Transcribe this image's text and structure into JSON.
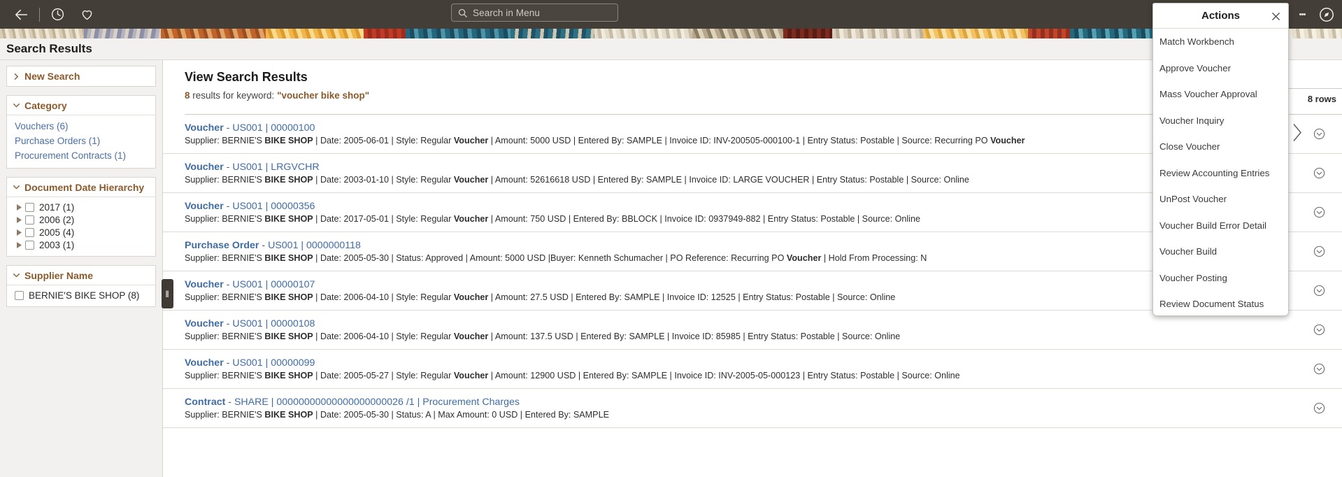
{
  "topbar": {
    "back_icon": "back-arrow-icon",
    "history_icon": "clock-icon",
    "favorites_icon": "heart-icon",
    "kebab_icon": "more-options-icon",
    "nav_icon": "compass-navbar-icon",
    "search": {
      "placeholder": "Search in Menu",
      "value": "",
      "icon": "search-icon"
    }
  },
  "page": {
    "title": "Search Results"
  },
  "sidebar": {
    "new_search": {
      "label": "New Search",
      "icon": "chevron-right-icon"
    },
    "facets": [
      {
        "title": "Category",
        "icon": "chevron-down-icon",
        "links": [
          "Vouchers (6)",
          "Purchase Orders (1)",
          "Procurement Contracts (1)"
        ]
      },
      {
        "title": "Document Date Hierarchy",
        "icon": "chevron-down-icon",
        "tree": [
          {
            "label": "2017 (1)",
            "checked": false
          },
          {
            "label": "2006 (2)",
            "checked": false
          },
          {
            "label": "2005 (4)",
            "checked": false
          },
          {
            "label": "2003 (1)",
            "checked": false
          }
        ]
      },
      {
        "title": "Supplier Name",
        "icon": "chevron-down-icon",
        "checkboxes": [
          {
            "label": "BERNIE'S BIKE SHOP (8)",
            "checked": false
          }
        ]
      }
    ],
    "collapse_handle": "‖"
  },
  "main": {
    "heading": "View Search Results",
    "result_count": "8",
    "results_text_mid": " results for keyword: ",
    "keyword": "\"voucher bike shop\"",
    "rows_badge": "8 rows",
    "results": [
      {
        "type": "Voucher",
        "sep": " - ",
        "ref": "US001 | 00000100",
        "detail": "Supplier: BERNIE'S BIKE SHOP | Date: 2005-06-01 | Style: Regular Voucher | Amount: 5000 USD | Entered By: SAMPLE | Invoice ID: INV-200505-000100-1 | Entry Status: Postable | Source: Recurring PO Voucher"
      },
      {
        "type": "Voucher",
        "sep": " - ",
        "ref": "US001 | LRGVCHR",
        "detail": "Supplier: BERNIE'S BIKE SHOP | Date: 2003-01-10 | Style: Regular Voucher | Amount: 52616618 USD | Entered By: SAMPLE | Invoice ID: LARGE VOUCHER | Entry Status: Postable | Source: Online"
      },
      {
        "type": "Voucher",
        "sep": " - ",
        "ref": "US001 | 00000356",
        "detail": "Supplier: BERNIE'S BIKE SHOP | Date: 2017-05-01 | Style: Regular Voucher | Amount: 750 USD | Entered By: BBLOCK | Invoice ID: 0937949-882 | Entry Status: Postable | Source: Online"
      },
      {
        "type": "Purchase Order",
        "sep": " - ",
        "ref": "US001 | 0000000118",
        "detail": "Supplier: BERNIE'S BIKE SHOP | Date: 2005-05-30 | Status: Approved | Amount: 5000 USD |Buyer: Kenneth Schumacher | PO Reference: Recurring PO Voucher | Hold From Processing: N"
      },
      {
        "type": "Voucher",
        "sep": " - ",
        "ref": "US001 | 00000107",
        "detail": "Supplier: BERNIE'S BIKE SHOP | Date: 2006-04-10 | Style: Regular Voucher | Amount: 27.5 USD | Entered By: SAMPLE | Invoice ID: 12525 | Entry Status: Postable | Source: Online"
      },
      {
        "type": "Voucher",
        "sep": " - ",
        "ref": "US001 | 00000108",
        "detail": "Supplier: BERNIE'S BIKE SHOP | Date: 2006-04-10 | Style: Regular Voucher | Amount: 137.5 USD | Entered By: SAMPLE | Invoice ID: 85985 | Entry Status: Postable | Source: Online"
      },
      {
        "type": "Voucher",
        "sep": " - ",
        "ref": "US001 | 00000099",
        "detail": "Supplier: BERNIE'S BIKE SHOP | Date: 2005-05-27 | Style: Regular Voucher | Amount: 12900 USD | Entered By: SAMPLE | Invoice ID: INV-2005-05-000123 | Entry Status: Postable | Source: Online"
      },
      {
        "type": "Contract",
        "sep": " - ",
        "ref": "SHARE | 00000000000000000000026 /1 | Procurement Charges",
        "detail": "Supplier: BERNIE'S BIKE SHOP | Date: 2005-05-30 | Status: A | Max Amount: 0 USD | Entered By: SAMPLE"
      }
    ]
  },
  "actions_panel": {
    "title": "Actions",
    "close_icon": "close-icon",
    "items": [
      "Match Workbench",
      "Approve Voucher",
      "Mass Voucher Approval",
      "Voucher Inquiry",
      "Close Voucher",
      "Review Accounting Entries",
      "UnPost Voucher",
      "Voucher Build Error Detail",
      "Voucher Build",
      "Voucher Posting",
      "Review Document Status"
    ]
  },
  "colors": {
    "topbar": "#433f38",
    "accent_brown": "#8a5a2b",
    "link_blue": "#3e6ca6",
    "page_bg": "#f2f1ef"
  }
}
